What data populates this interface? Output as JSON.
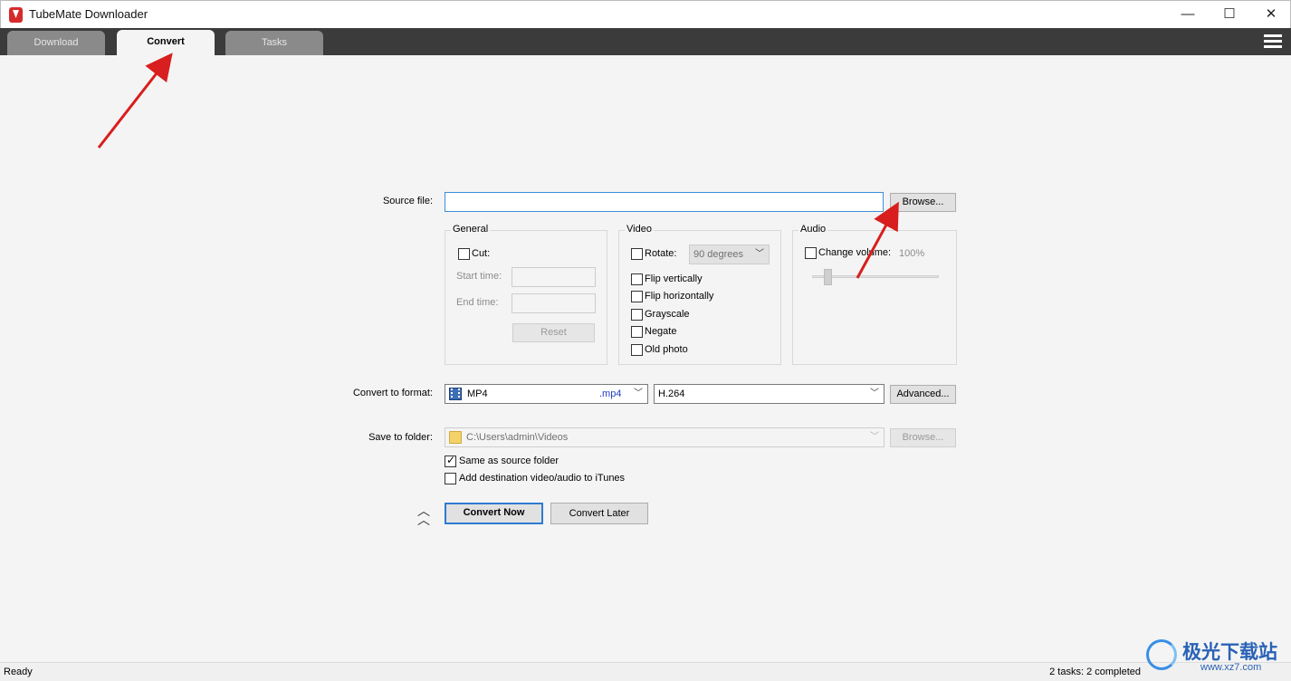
{
  "window": {
    "title": "TubeMate Downloader",
    "min": "—",
    "max": "☐",
    "close": "✕"
  },
  "tabs": [
    {
      "label": "Download"
    },
    {
      "label": "Convert"
    },
    {
      "label": "Tasks"
    }
  ],
  "source": {
    "label": "Source file:",
    "value": "",
    "browse": "Browse..."
  },
  "general": {
    "title": "General",
    "cut_label": "Cut:",
    "start_label": "Start time:",
    "end_label": "End time:",
    "reset": "Reset"
  },
  "video": {
    "title": "Video",
    "rotate_label": "Rotate:",
    "rotate_value": "90 degrees",
    "options": [
      "Flip vertically",
      "Flip horizontally",
      "Grayscale",
      "Negate",
      "Old photo"
    ]
  },
  "audio": {
    "title": "Audio",
    "volume_label": "Change volume:",
    "volume_value": "100%",
    "volume_level": 0.12
  },
  "format": {
    "label": "Convert to format:",
    "container": "MP4",
    "extension": ".mp4",
    "codec": "H.264",
    "advanced": "Advanced..."
  },
  "folder": {
    "label": "Save to folder:",
    "path": "C:\\Users\\admin\\Videos",
    "browse": "Browse...",
    "same_as_source": "Same as source folder",
    "same_as_source_checked": true,
    "itunes": "Add destination video/audio to iTunes",
    "itunes_checked": false
  },
  "actions": {
    "convert_now": "Convert Now",
    "convert_later": "Convert Later"
  },
  "status": {
    "left": "Ready",
    "right": "2 tasks: 2 completed"
  },
  "watermark": {
    "big": "极光下载站",
    "small": "www.xz7.com"
  },
  "colors": {
    "accent": "#2f7bd0",
    "tabbar": "#3b3b3b",
    "annotation": "#d81e1e"
  }
}
